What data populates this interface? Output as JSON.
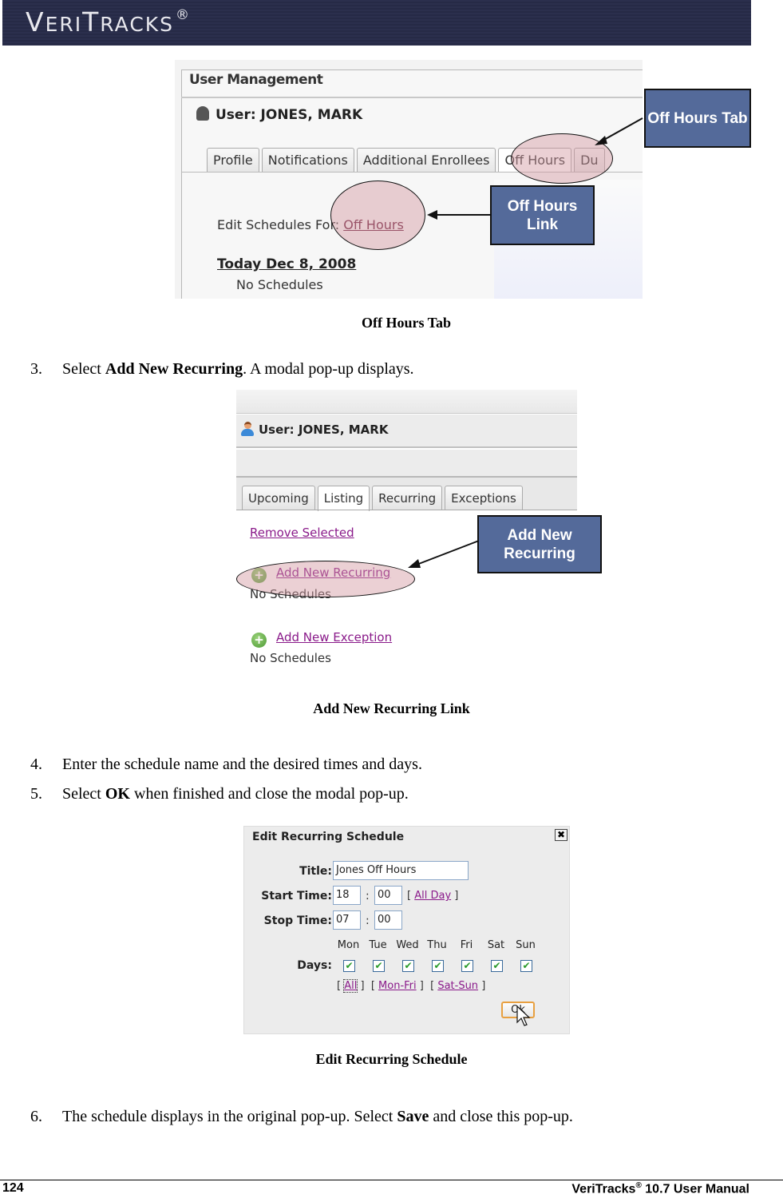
{
  "header": {
    "brand_first": "V",
    "brand_rest1": "ERI",
    "brand_t": "T",
    "brand_rest2": "RACKS",
    "brand_mark": "®"
  },
  "figure1": {
    "panel_title": "User Management",
    "user_label": "User: JONES, MARK",
    "tabs": [
      "Profile",
      "Notifications",
      "Additional Enrollees",
      "Off Hours",
      "Du"
    ],
    "active_tab": "Off Hours",
    "edit_schedules_label": "Edit Schedules For:",
    "edit_schedules_link": "Off Hours",
    "date_heading": "Today Dec 8, 2008",
    "no_schedules": "No Schedules",
    "callouts": {
      "off_hours_tab": "Off Hours Tab",
      "off_hours_link": "Off Hours Link"
    },
    "caption": "Off Hours Tab"
  },
  "steps": {
    "step3": {
      "num": "3.",
      "pre": "Select ",
      "bold": "Add New Recurring",
      "post": ". A modal pop-up displays."
    },
    "step4": {
      "num": "4.",
      "text": "Enter the schedule name and the desired times and days."
    },
    "step5": {
      "num": "5.",
      "pre": "Select ",
      "bold": "OK",
      "post": " when finished and close the modal pop-up."
    },
    "step6": {
      "num": "6.",
      "pre": "The schedule displays in the original pop-up. Select ",
      "bold": "Save",
      "post": " and close this pop-up."
    }
  },
  "figure2": {
    "user_label": "User: JONES, MARK",
    "tabs": [
      "Upcoming",
      "Listing",
      "Recurring",
      "Exceptions"
    ],
    "active_tab": "Listing",
    "remove_selected": "Remove Selected",
    "add_new_recurring": "Add New Recurring",
    "no_schedules_1": "No Schedules",
    "add_new_exception": "Add New Exception",
    "no_schedules_2": "No Schedules",
    "callout": "Add New Recurring",
    "caption": "Add New Recurring Link"
  },
  "figure3": {
    "dialog_title": "Edit Recurring Schedule",
    "close_glyph": "✖",
    "title_label": "Title:",
    "title_value": "Jones Off Hours",
    "start_label": "Start Time:",
    "start_hour": "18",
    "start_min": "00",
    "all_day_link": "All Day",
    "stop_label": "Stop Time:",
    "stop_hour": "07",
    "stop_min": "00",
    "days_label": "Days:",
    "days": [
      {
        "name": "Mon",
        "checked": true
      },
      {
        "name": "Tue",
        "checked": true
      },
      {
        "name": "Wed",
        "checked": true
      },
      {
        "name": "Thu",
        "checked": true
      },
      {
        "name": "Fri",
        "checked": true
      },
      {
        "name": "Sat",
        "checked": true
      },
      {
        "name": "Sun",
        "checked": true
      }
    ],
    "check_glyph": "✔",
    "quick_links": [
      "All",
      "Mon-Fri",
      "Sat-Sun"
    ],
    "ok_label": "Ok",
    "caption": "Edit Recurring Schedule"
  },
  "footer": {
    "page_number": "124",
    "manual_pre": "VeriTracks",
    "manual_mark": "®",
    "manual_post": " 10.7 User Manual"
  },
  "colors": {
    "banner": "#2b2f4d",
    "callout_fill": "#546a9a",
    "highlight_ellipse": "#d2969f",
    "link_purple": "#8a1a8a"
  }
}
